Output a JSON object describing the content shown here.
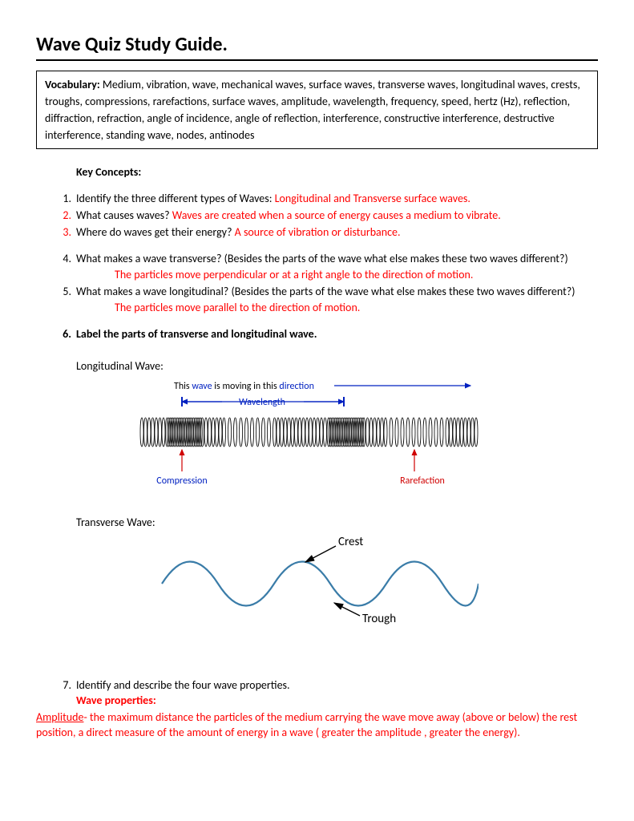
{
  "title": "Wave Quiz Study Guide.",
  "vocab": {
    "label": "Vocabulary:",
    "text": " Medium, vibration, wave, mechanical waves, surface waves, transverse waves, longitudinal waves, crests, troughs, compressions, rarefactions, surface waves, amplitude, wavelength, frequency, speed, hertz (Hz), reflection, diffraction, refraction, angle of incidence, angle of reflection, interference, constructive interference, destructive interference, standing wave, nodes, antinodes"
  },
  "keyConceptsHeading": "Key Concepts:",
  "items": {
    "q1": "Identify the three different types of Waves: ",
    "a1": "Longitudinal and Transverse surface waves.",
    "q2": "What causes waves? ",
    "a2": "Waves are created when a source of energy causes a medium to vibrate.",
    "q3": "Where do waves get their energy? ",
    "a3": "A source of vibration or disturbance.",
    "q4": "What makes a wave transverse? (Besides the parts of the wave what else makes these two waves different?)",
    "a4": "The particles move perpendicular  or at a right angle to the direction of motion.",
    "q5": " What makes a wave longitudinal? (Besides the parts of the wave what else makes these two waves different?)",
    "a5": "The particles move parallel to the direction of motion.",
    "q6": "Label the parts of transverse and longitudinal wave.",
    "longitudinalLabel": "Longitudinal Wave:",
    "transverseLabel": "Transverse Wave:",
    "q7": "Identify and describe the four wave properties.",
    "wavePropsLabel": "Wave properties:",
    "amplitudeLabel": "Amplitude",
    "amplitudeText": "- the maximum distance the particles of the medium carrying the wave move away (above or below) the rest position, a direct measure of the amount of energy in a wave ( greater the amplitude , greater the energy)."
  },
  "diagram": {
    "movingText1": "This ",
    "movingWave": "wave",
    "movingText2": " is moving in this ",
    "movingDirection": "direction",
    "wavelength": "Wavelength",
    "compression": "Compression",
    "rarefaction": "Rarefaction",
    "crest": "Crest",
    "trough": "Trough"
  }
}
